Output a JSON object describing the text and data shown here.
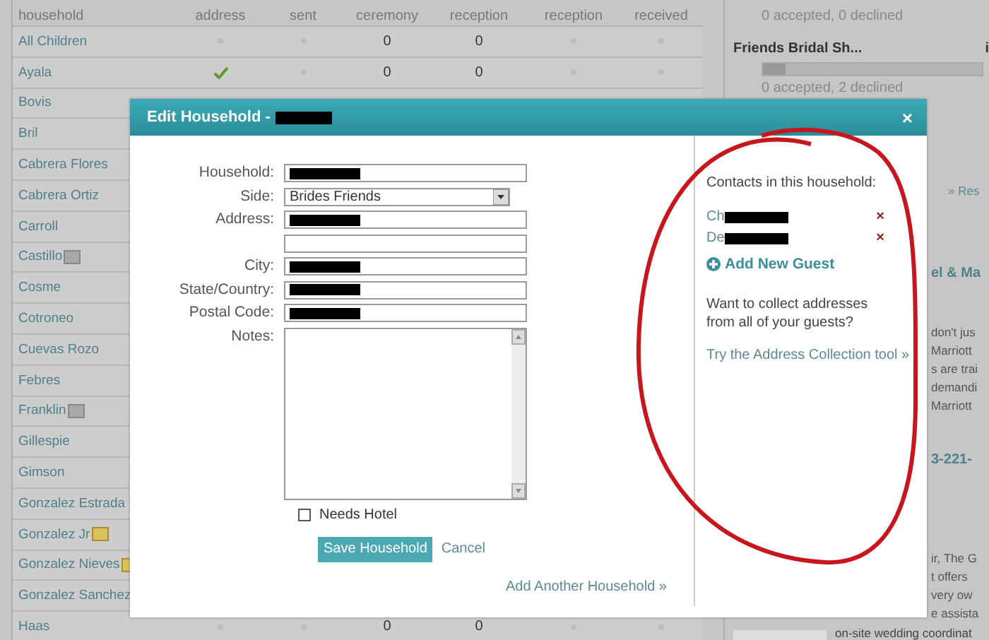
{
  "table": {
    "columns": [
      "household",
      "address",
      "sent",
      "ceremony",
      "reception",
      "reception",
      "received"
    ],
    "rows": [
      {
        "name": "All Children",
        "cells": [
          {
            "kind": "dot"
          },
          {
            "kind": "dot"
          },
          {
            "kind": "text",
            "text": "0"
          },
          {
            "kind": "text",
            "text": "0"
          },
          {
            "kind": "dot"
          },
          {
            "kind": "dot"
          }
        ]
      },
      {
        "name": "Ayala",
        "cells": [
          {
            "kind": "check"
          },
          {
            "kind": "dot"
          },
          {
            "kind": "text",
            "text": "0"
          },
          {
            "kind": "text",
            "text": "0"
          },
          {
            "kind": "dot"
          },
          {
            "kind": "dot"
          }
        ]
      },
      {
        "name": "Bovis"
      },
      {
        "name": "Bril"
      },
      {
        "name": "Cabrera Flores"
      },
      {
        "name": "Cabrera Ortiz"
      },
      {
        "name": "Carroll"
      },
      {
        "name": "Castillo",
        "card_icon": true
      },
      {
        "name": "Cosme"
      },
      {
        "name": "Cotroneo"
      },
      {
        "name": "Cuevas Rozo"
      },
      {
        "name": "Febres"
      },
      {
        "name": "Franklin",
        "card_icon": true
      },
      {
        "name": "Gillespie"
      },
      {
        "name": "Gimson"
      },
      {
        "name": "Gonzalez Estrada"
      },
      {
        "name": "Gonzalez Jr",
        "note_icon": true
      },
      {
        "name": "Gonzalez Nieves",
        "note_icon": true
      },
      {
        "name": "Gonzalez Sanchez"
      },
      {
        "name": "Haas",
        "cells": [
          {
            "kind": "dot"
          },
          {
            "kind": "dot"
          },
          {
            "kind": "text",
            "text": "0"
          },
          {
            "kind": "text",
            "text": "0"
          },
          {
            "kind": "dot"
          },
          {
            "kind": "dot"
          }
        ]
      }
    ]
  },
  "side_panel": {
    "events": [
      {
        "status": "0 accepted, 0 declined"
      },
      {
        "title": "Friends Bridal Sh...",
        "tag": "i",
        "level": 0.1,
        "status": "0 accepted, 2 declined"
      }
    ],
    "fragments": [
      {
        "kind": "link",
        "text": "» Res"
      },
      {
        "kind": "heading",
        "text": "el & Ma"
      },
      {
        "kind": "line",
        "text": "don't jus"
      },
      {
        "kind": "line",
        "text": "Marriott"
      },
      {
        "kind": "line",
        "text": "s are trai"
      },
      {
        "kind": "line",
        "text": "demandi"
      },
      {
        "kind": "line",
        "text": "Marriott"
      },
      {
        "kind": "heading",
        "text": "3-221-"
      },
      {
        "kind": "line",
        "text": "ir, The G"
      },
      {
        "kind": "line",
        "text": "t offers"
      },
      {
        "kind": "line",
        "text": "very ow"
      },
      {
        "kind": "line",
        "text": "e assista"
      }
    ],
    "caption": "on-site wedding coordinat"
  },
  "dialog": {
    "title": "Edit Household -",
    "title_redacted": true,
    "close_label": "×",
    "fields": [
      {
        "label": "Household:",
        "kind": "text",
        "redacted": true
      },
      {
        "label": "Side:",
        "kind": "select",
        "value": "Brides Friends"
      },
      {
        "label": "Address:",
        "kind": "text",
        "redacted": true
      },
      {
        "kind": "text"
      },
      {
        "label": "City:",
        "kind": "text",
        "redacted": true
      },
      {
        "label": "State/Country:",
        "kind": "text",
        "redacted": true
      },
      {
        "label": "Postal Code:",
        "kind": "text",
        "redacted": true
      },
      {
        "label": "Notes:",
        "kind": "textarea"
      }
    ],
    "checkbox": {
      "label": "Needs Hotel",
      "checked": false
    },
    "save": "Save Household",
    "cancel": "Cancel",
    "add_another": "Add Another Household »",
    "contacts_heading": "Contacts in this household:",
    "contacts": [
      {
        "name": "Ch",
        "redacted": true,
        "remove_label": "×"
      },
      {
        "name": "De",
        "redacted": true,
        "remove_label": "×"
      }
    ],
    "add_guest": "Add New Guest",
    "prompt": "Want to collect addresses from all of your guests?",
    "prompt_link": "Try the Address Collection tool »"
  }
}
